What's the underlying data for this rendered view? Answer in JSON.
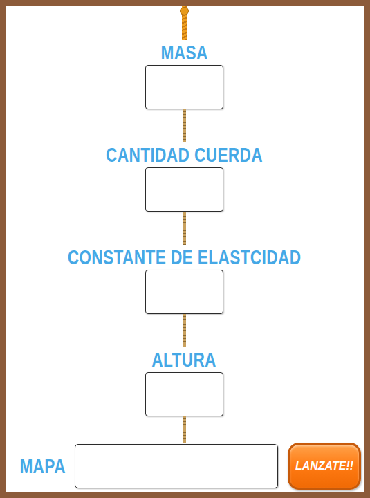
{
  "fields": [
    {
      "label": "MASA"
    },
    {
      "label": "CANTIDAD CUERDA"
    },
    {
      "label": "CONSTANTE DE ELASTCIDAD"
    },
    {
      "label": "ALTURA"
    }
  ],
  "map": {
    "label": "MAPA"
  },
  "button": {
    "label": "LANZATE!!"
  }
}
